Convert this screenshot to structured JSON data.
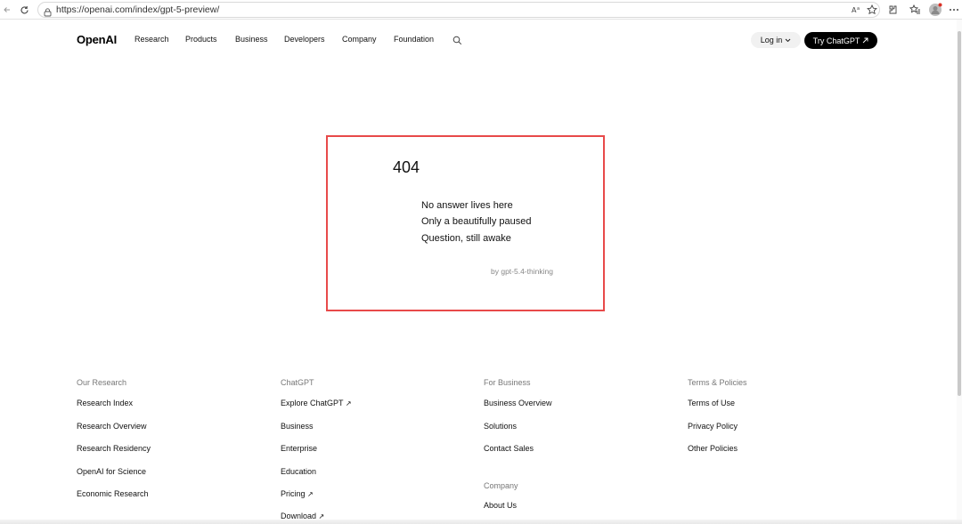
{
  "browser": {
    "url": "https://openai.com/index/gpt-5-preview/",
    "icons": [
      "back-arrow-icon",
      "reload-icon",
      "lock-icon",
      "read-aloud-icon",
      "favorite-star-icon",
      "extensions-icon",
      "favorites-icon",
      "profile-avatar-icon",
      "more-menu-icon"
    ]
  },
  "nav": {
    "logo": "OpenAI",
    "items": [
      "Research",
      "Products",
      "Business",
      "Developers",
      "Company",
      "Foundation"
    ],
    "login": "Log in",
    "cta": "Try ChatGPT"
  },
  "error": {
    "code": "404",
    "lines": [
      "No answer lives here",
      "Only a beautifully paused",
      "Question, still awake"
    ],
    "byline": "by gpt-5.4-thinking",
    "border_color": "#e84a4a"
  },
  "footer": {
    "col1": {
      "heading": "Our Research",
      "links": [
        "Research Index",
        "Research Overview",
        "Research Residency",
        "OpenAI for Science",
        "Economic Research"
      ]
    },
    "col2": {
      "heading": "ChatGPT",
      "links": [
        "Explore ChatGPT",
        "Business",
        "Enterprise",
        "Education",
        "Pricing",
        "Download"
      ]
    },
    "col3": {
      "heading": "For Business",
      "links": [
        "Business Overview",
        "Solutions",
        "Contact Sales"
      ],
      "heading2": "Company",
      "links2": [
        "About Us"
      ]
    },
    "col4": {
      "heading": "Terms & Policies",
      "links": [
        "Terms of Use",
        "Privacy Policy",
        "Other Policies"
      ]
    }
  }
}
